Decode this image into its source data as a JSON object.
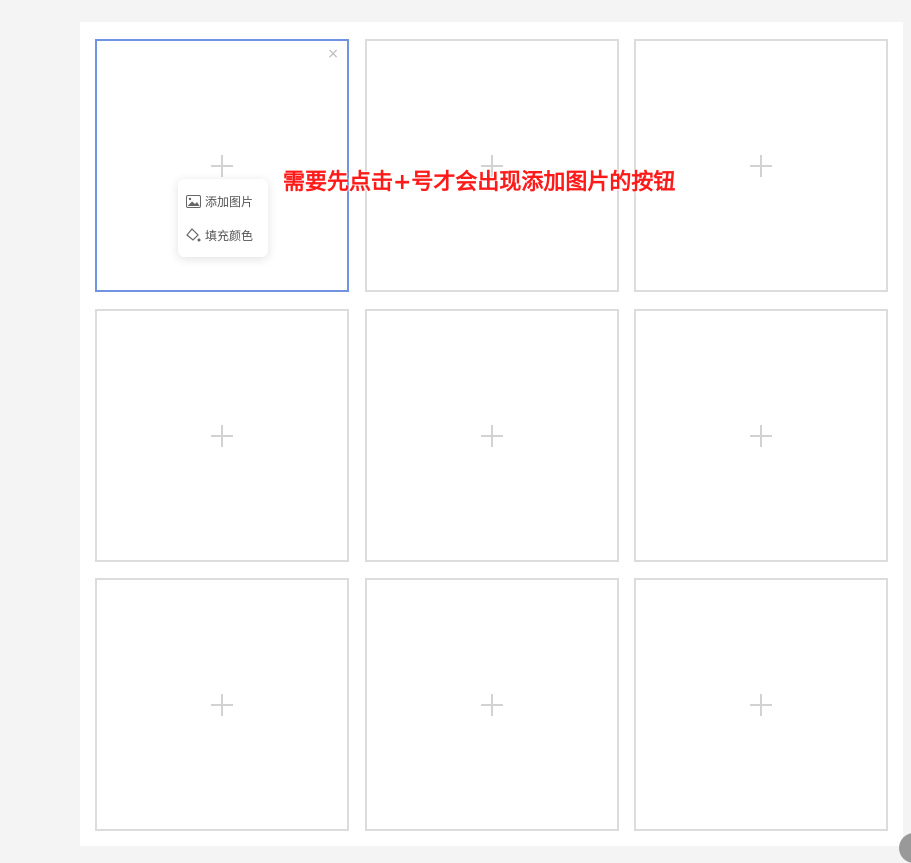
{
  "grid": {
    "cells": [
      {
        "icon": "plus-icon",
        "active": true
      },
      {
        "icon": "plus-icon"
      },
      {
        "icon": "plus-icon"
      },
      {
        "icon": "plus-icon"
      },
      {
        "icon": "plus-icon"
      },
      {
        "icon": "plus-icon"
      },
      {
        "icon": "plus-icon"
      },
      {
        "icon": "plus-icon"
      },
      {
        "icon": "plus-icon"
      }
    ],
    "close_glyph": "×"
  },
  "popover": {
    "add_image": "添加图片",
    "fill_color": "填充颜色"
  },
  "annotation": "需要先点击+号才会出现添加图片的按钮",
  "colors": {
    "active_border": "#7094e0",
    "annotation": "#ff1a1a"
  }
}
